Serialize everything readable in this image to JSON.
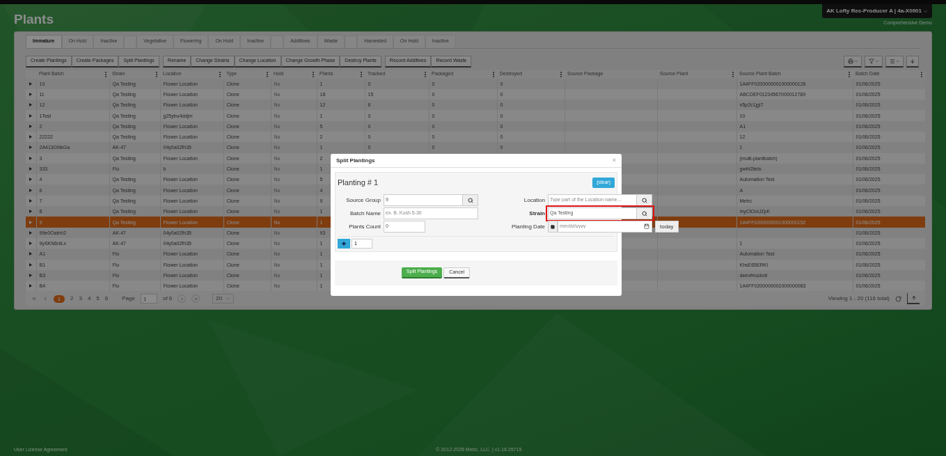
{
  "page_title": "Plants",
  "account": {
    "name": "AK Lofty Rec-Producer A | 4a-X0001",
    "subtitle": "Comprehensive Demo"
  },
  "tab_groups": [
    [
      {
        "label": "Immature",
        "selected": true
      },
      {
        "label": "On Hold",
        "selected": false
      },
      {
        "label": "Inactive",
        "selected": false
      }
    ],
    [
      {
        "label": "Vegetative",
        "selected": false
      },
      {
        "label": "Flowering",
        "selected": false
      },
      {
        "label": "On Hold",
        "selected": false
      },
      {
        "label": "Inactive",
        "selected": false
      }
    ],
    [
      {
        "label": "Additives",
        "selected": false
      },
      {
        "label": "Waste",
        "selected": false
      }
    ],
    [
      {
        "label": "Harvested",
        "selected": false
      },
      {
        "label": "On Hold",
        "selected": false
      },
      {
        "label": "Inactive",
        "selected": false
      }
    ]
  ],
  "action_groups": [
    [
      "Create Plantings",
      "Create Packages",
      "Split Plantings"
    ],
    [
      "Rename",
      "Change Strains",
      "Change Location",
      "Change Growth Phase",
      "Destroy Plants"
    ],
    [
      "Record Additives",
      "Record Waste"
    ]
  ],
  "table": {
    "columns": [
      "Plant Batch",
      "Strain",
      "Location",
      "Type",
      "Hold",
      "Plants",
      "Tracked",
      "Packaged",
      "Destroyed",
      "Source Package",
      "Source Plant",
      "Source Plant Batch",
      "Batch Date"
    ],
    "rows": [
      {
        "selected": false,
        "cells": [
          "10",
          "Qa Testing",
          "Flower Location",
          "Clone",
          "No",
          "1",
          "0",
          "0",
          "0",
          null,
          null,
          "1A4FF0200000001000000126",
          "01/06/2025"
        ]
      },
      {
        "selected": false,
        "cells": [
          "11",
          "Qa Testing",
          "Flower Location",
          "Clone",
          "No",
          "18",
          "15",
          "0",
          "0",
          null,
          null,
          "ABCDEF01234567000012789",
          "01/06/2025"
        ]
      },
      {
        "selected": false,
        "cells": [
          "12",
          "Qa Testing",
          "Flower Location",
          "Clone",
          "No",
          "12",
          "6",
          "0",
          "0",
          null,
          null,
          "n5p2c1jgl7",
          "01/06/2025"
        ]
      },
      {
        "selected": false,
        "cells": [
          "1Test",
          "Qa Testing",
          "g25ybu4ddjm",
          "Clone",
          "No",
          "1",
          "0",
          "0",
          "0",
          null,
          null,
          "10",
          "01/06/2025"
        ]
      },
      {
        "selected": false,
        "cells": [
          "2",
          "Qa Testing",
          "Flower Location",
          "Clone",
          "No",
          "5",
          "0",
          "0",
          "0",
          null,
          null,
          "A1",
          "01/06/2025"
        ]
      },
      {
        "selected": false,
        "cells": [
          "22222",
          "Qa Testing",
          "Flower Location",
          "Clone",
          "No",
          "2",
          "0",
          "0",
          "0",
          null,
          null,
          "12",
          "01/06/2025"
        ]
      },
      {
        "selected": false,
        "cells": [
          "2A413GNkGa",
          "AK-47",
          "04y0a02fh35",
          "Clone",
          "No",
          "1",
          "0",
          "0",
          "0",
          null,
          null,
          "1",
          "01/06/2025"
        ]
      },
      {
        "selected": false,
        "cells": [
          "3",
          "Qa Testing",
          "Flower Location",
          "Clone",
          "No",
          "2",
          null,
          null,
          null,
          null,
          null,
          "(multi-plantbatch)",
          "01/06/2025"
        ]
      },
      {
        "selected": false,
        "cells": [
          "333",
          "Flo",
          "b",
          "Clone",
          "No",
          "1",
          null,
          null,
          null,
          null,
          null,
          "gwfri2lielo",
          "01/06/2025"
        ]
      },
      {
        "selected": false,
        "cells": [
          "4",
          "Qa Testing",
          "Flower Location",
          "Clone",
          "No",
          "5",
          null,
          null,
          null,
          null,
          null,
          "Automation Test",
          "01/06/2025"
        ]
      },
      {
        "selected": false,
        "cells": [
          "6",
          "Qa Testing",
          "Flower Location",
          "Clone",
          "No",
          "4",
          null,
          null,
          null,
          null,
          null,
          "A",
          "01/06/2025"
        ]
      },
      {
        "selected": false,
        "cells": [
          "7",
          "Qa Testing",
          "Flower Location",
          "Clone",
          "No",
          "9",
          null,
          null,
          null,
          null,
          null,
          "Metrc",
          "01/06/2025"
        ]
      },
      {
        "selected": false,
        "cells": [
          "8",
          "Qa Testing",
          "Flower Location",
          "Clone",
          "No",
          "1",
          null,
          null,
          null,
          null,
          null,
          "myCtOoUZpK",
          "01/06/2025"
        ]
      },
      {
        "selected": true,
        "cells": [
          "9",
          "Qa Testing",
          "Flower Location",
          "Clone",
          "No",
          "1",
          null,
          null,
          null,
          null,
          null,
          "1A4FF0200000001000000152",
          "01/06/2025"
        ]
      },
      {
        "selected": false,
        "cells": [
          "99e0Oatnh2",
          "AK-47",
          "04y0a02fh35",
          "Clone",
          "No",
          "93",
          null,
          null,
          null,
          null,
          null,
          null,
          "01/06/2025"
        ]
      },
      {
        "selected": false,
        "cells": [
          "9ySKN6nlLx",
          "AK-47",
          "04y0a02fh35",
          "Clone",
          "No",
          "1",
          null,
          null,
          null,
          null,
          null,
          "1",
          "01/06/2025"
        ]
      },
      {
        "selected": false,
        "cells": [
          "A1",
          "Flo",
          "Flower Location",
          "Clone",
          "No",
          "1",
          null,
          null,
          null,
          null,
          null,
          "Automation Test",
          "01/06/2025"
        ]
      },
      {
        "selected": false,
        "cells": [
          "B1",
          "Flo",
          "Flower Location",
          "Clone",
          "No",
          "1",
          null,
          null,
          null,
          null,
          null,
          "KhsE65ERKl",
          "01/06/2025"
        ]
      },
      {
        "selected": false,
        "cells": [
          "B3",
          "Flo",
          "Flower Location",
          "Clone",
          "No",
          "1",
          null,
          null,
          null,
          null,
          null,
          "deevfmudvdl",
          "01/06/2025"
        ]
      },
      {
        "selected": false,
        "cells": [
          "B4",
          "Flo",
          "Flower Location",
          "Clone",
          "No",
          "1",
          null,
          null,
          null,
          null,
          null,
          "1A4FF0200000001000000083",
          "01/06/2025"
        ]
      }
    ]
  },
  "pager": {
    "pages": [
      {
        "label": "1",
        "selected": true
      },
      {
        "label": "2",
        "selected": false
      },
      {
        "label": "3",
        "selected": false
      },
      {
        "label": "4",
        "selected": false
      },
      {
        "label": "5",
        "selected": false
      },
      {
        "label": "6",
        "selected": false
      }
    ],
    "page_label": "Page",
    "page_value": "1",
    "of_label": "of 6",
    "page_size": "20",
    "viewing": "Viewing 1 - 20 (116 total)"
  },
  "dialog": {
    "title": "Split Plantings",
    "close": "×",
    "planting_title": "Planting # 1",
    "clear_button": "(clear)",
    "fields_left": [
      {
        "label": "Source Group",
        "value": "9",
        "kind": "lookup",
        "highlighted": false
      },
      {
        "label": "Batch Name",
        "placeholder": "ex. B. Kush 5-30",
        "kind": "text",
        "highlighted": false
      },
      {
        "label": "Plants Count",
        "value": "0",
        "kind": "short",
        "highlighted": false
      }
    ],
    "fields_right": [
      {
        "label": "Location",
        "placeholder": "Type part of the Location name...",
        "kind": "lookup",
        "highlighted": false
      },
      {
        "label": "Strain",
        "value": "Qa Testing",
        "kind": "lookup",
        "highlighted": true
      },
      {
        "label": "Planting Date",
        "placeholder": "mm/dd/yyyy",
        "kind": "date",
        "button": "today",
        "highlighted": false
      }
    ],
    "add_count": "1",
    "submit": "Split Plantings",
    "cancel": "Cancel"
  },
  "footer": {
    "left": "User License Agreement",
    "center": "© 2012-2025 Metrc, LLC. | v1.16.25715"
  }
}
